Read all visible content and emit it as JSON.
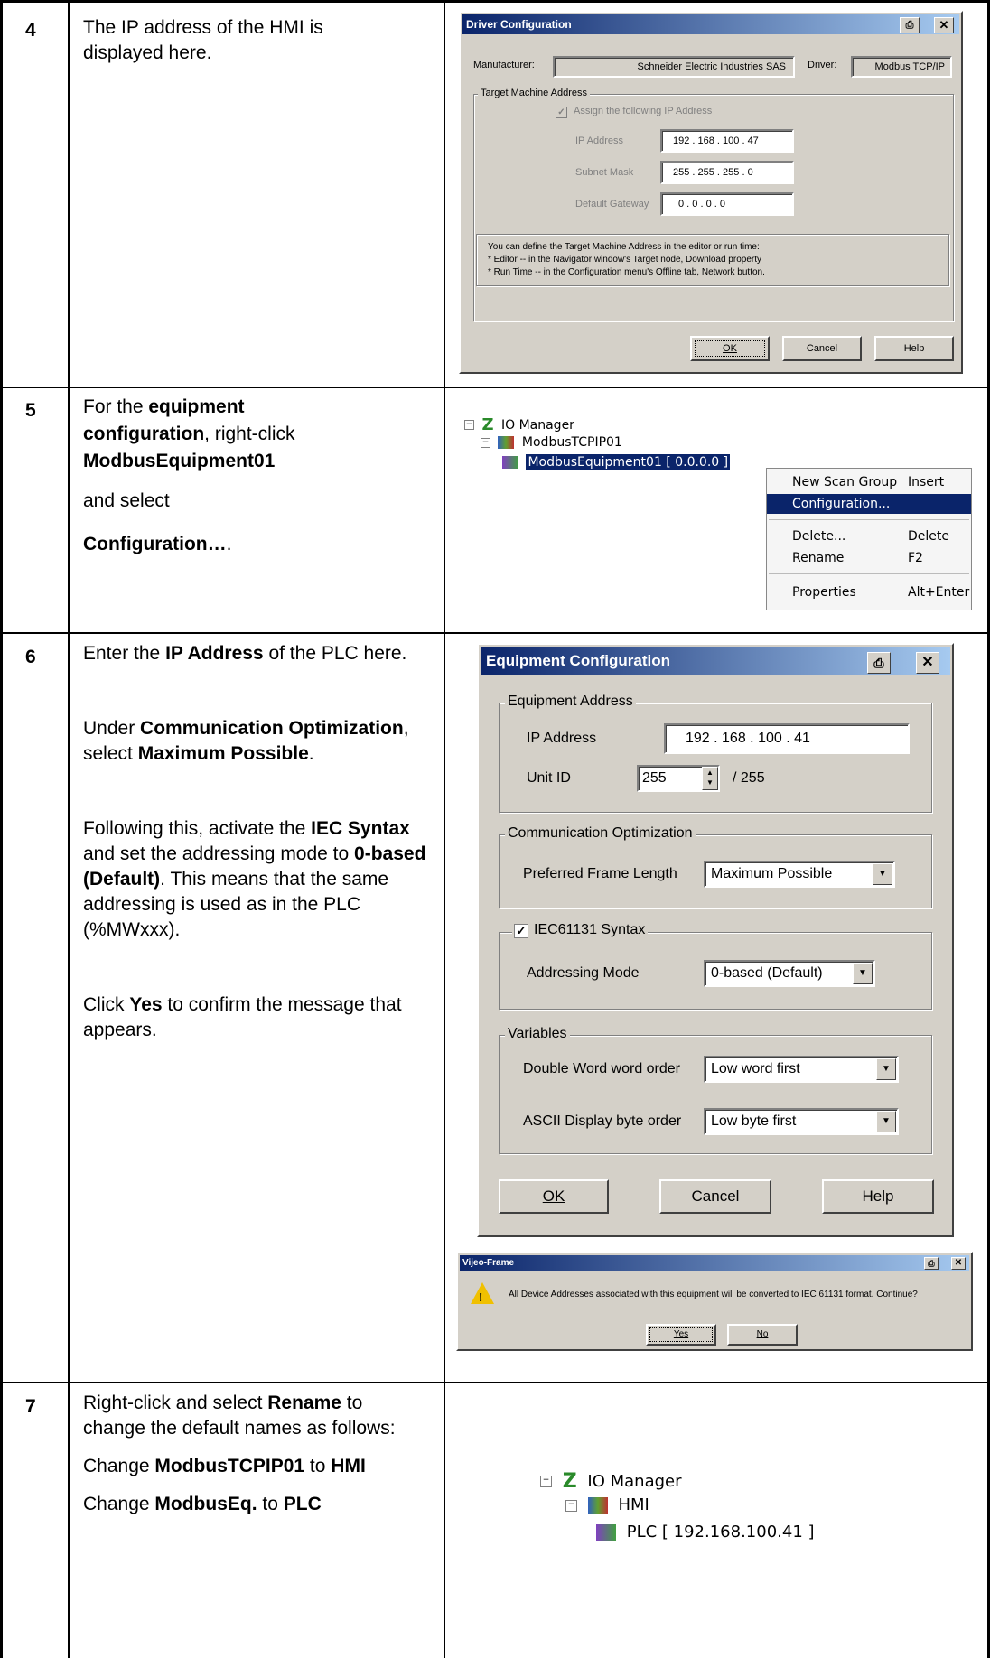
{
  "rows": [
    {
      "num": "4"
    },
    {
      "num": "5"
    },
    {
      "num": "6"
    },
    {
      "num": "7"
    }
  ],
  "row4": {
    "text": "The IP address of the HMI is displayed here.",
    "dialog": {
      "title": "Driver Configuration",
      "manufacturer_label": "Manufacturer:",
      "manufacturer_value": "Schneider Electric Industries SAS",
      "driver_label": "Driver:",
      "driver_value": "Modbus TCP/IP",
      "group_title": "Target Machine Address",
      "assign_label": "Assign the following IP Address",
      "ip_label": "IP Address",
      "ip_value": "192 . 168 . 100 . 47",
      "subnet_label": "Subnet Mask",
      "subnet_value": "255 . 255 . 255 . 0",
      "gateway_label": "Default Gateway",
      "gateway_value": "0 . 0 . 0 . 0",
      "info_line1": "You can define the Target Machine Address in the editor or run time:",
      "info_line2": "* Editor -- in the Navigator window's Target node, Download property",
      "info_line3": "* Run Time -- in the Configuration menu's Offline tab, Network button.",
      "ok": "OK",
      "cancel": "Cancel",
      "help": "Help"
    }
  },
  "row5": {
    "line1_pre": "For the ",
    "line1_bold": "equipment",
    "line2_bold": "configuration",
    "line2_post": ", right-click",
    "line3_bold": "ModbusEquipment01",
    "line4": "and select",
    "line5_bold": "Configuration…",
    "line5_post": ".",
    "tree": {
      "root": "IO Manager",
      "driver": "ModbusTCPIP01",
      "equipment": "ModbusEquipment01 [ 0.0.0.0 ]"
    },
    "menu": [
      {
        "label": "New Scan Group",
        "shortcut": "Insert"
      },
      {
        "label": "Configuration...",
        "shortcut": ""
      },
      {
        "label": "Delete...",
        "shortcut": "Delete"
      },
      {
        "label": "Rename",
        "shortcut": "F2"
      },
      {
        "label": "Properties",
        "shortcut": "Alt+Enter"
      }
    ]
  },
  "row6": {
    "p1_pre": "Enter the ",
    "p1_bold": "IP Address",
    "p1_post": " of the PLC here.",
    "p2_pre": "Under ",
    "p2_bold1": "Communication Optimization",
    "p2_mid": ", select ",
    "p2_bold2": "Maximum Possible",
    "p2_post": ".",
    "p3_pre": "Following this, activate the ",
    "p3_bold1": "IEC Syntax",
    "p3_mid": " and set the addressing mode to ",
    "p3_bold2": "0-based (Default)",
    "p3_post": ". This means that the same addressing is used as in the PLC (%MWxxx).",
    "p4_pre": "Click ",
    "p4_bold": "Yes",
    "p4_post": " to confirm the message that appears.",
    "dialog": {
      "title": "Equipment Configuration",
      "grp_address": "Equipment Address",
      "ip_label": "IP Address",
      "ip_value": "192  .  168  .  100  .  41",
      "unitid_label": "Unit ID",
      "unitid_value": "255",
      "unitid_max": "/ 255",
      "grp_comm": "Communication Optimization",
      "frame_label": "Preferred Frame Length",
      "frame_value": "Maximum Possible",
      "grp_iec": "IEC61131 Syntax",
      "addr_mode_label": "Addressing Mode",
      "addr_mode_value": "0-based (Default)",
      "grp_vars": "Variables",
      "dword_label": "Double Word word order",
      "dword_value": "Low word first",
      "ascii_label": "ASCII Display byte order",
      "ascii_value": "Low byte first",
      "ok": "OK",
      "cancel": "Cancel",
      "help": "Help"
    },
    "msgbox": {
      "title": "Vijeo-Frame",
      "message": "All Device Addresses associated with this equipment will be converted to IEC 61131 format. Continue?",
      "yes": "Yes",
      "no": "No"
    }
  },
  "row7": {
    "l1_pre": "Right-click and select ",
    "l1_bold": "Rename",
    "l1_post": " to change the default names as follows:",
    "l2_pre": "Change ",
    "l2_bold1": "ModbusTCPIP01",
    "l2_mid": " to ",
    "l2_bold2": "HMI",
    "l3_pre": "Change ",
    "l3_bold1": "ModbusEq.",
    "l3_mid": " to ",
    "l3_bold2": "PLC",
    "tree": {
      "root": "IO Manager",
      "driver": "HMI",
      "equipment": "PLC [ 192.168.100.41 ]"
    }
  }
}
